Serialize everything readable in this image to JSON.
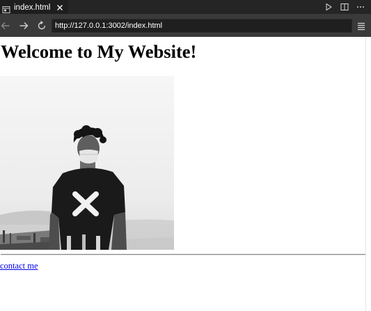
{
  "browser": {
    "tab": {
      "title": "index.html",
      "icon": "preview-tab-icon"
    },
    "tab_actions": [
      "play-icon",
      "split-editor-icon",
      "more-icon"
    ],
    "nav": {
      "back_icon": "arrow-left-icon",
      "forward_icon": "arrow-right-icon",
      "reload_icon": "reload-icon",
      "menu_icon": "menu-icon"
    },
    "url": "http://127.0.0.1:3002/index.html"
  },
  "page": {
    "heading": "Welcome to My Website!",
    "image": {
      "subject": "grayscale photo of a person wearing a face mask and a black X t-shirt"
    },
    "contact_link": "contact me"
  },
  "colors": {
    "tab_bar": "#252526",
    "active_tab": "#1e1e1e",
    "nav_bar": "#3a3a3b",
    "url_field": "#1f1f1f",
    "link": "#0000ee"
  }
}
